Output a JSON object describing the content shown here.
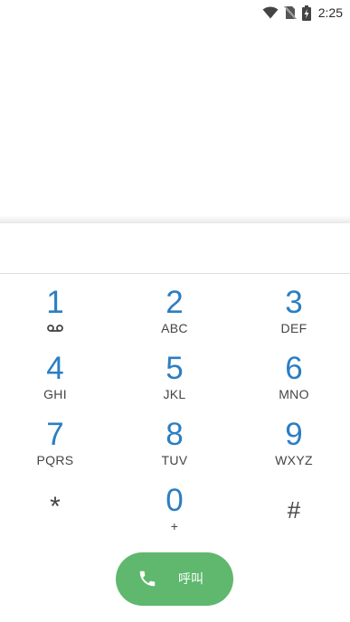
{
  "status_bar": {
    "time": "2:25",
    "icons": [
      "wifi-icon",
      "no-sim-icon",
      "battery-charging-icon"
    ]
  },
  "dialpad": {
    "keys": [
      {
        "digit": "1",
        "letters": "",
        "icon": "voicemail-icon"
      },
      {
        "digit": "2",
        "letters": "ABC"
      },
      {
        "digit": "3",
        "letters": "DEF"
      },
      {
        "digit": "4",
        "letters": "GHI"
      },
      {
        "digit": "5",
        "letters": "JKL"
      },
      {
        "digit": "6",
        "letters": "MNO"
      },
      {
        "digit": "7",
        "letters": "PQRS"
      },
      {
        "digit": "8",
        "letters": "TUV"
      },
      {
        "digit": "9",
        "letters": "WXYZ"
      },
      {
        "digit": "*",
        "letters": ""
      },
      {
        "digit": "0",
        "letters": "+"
      },
      {
        "digit": "#",
        "letters": ""
      }
    ]
  },
  "number_field": {
    "value": ""
  },
  "call_button": {
    "label": "呼叫",
    "icon": "phone-icon",
    "color": "#5fb86d"
  },
  "colors": {
    "digit": "#2c7ec2",
    "letters": "#444444",
    "background": "#ffffff"
  }
}
